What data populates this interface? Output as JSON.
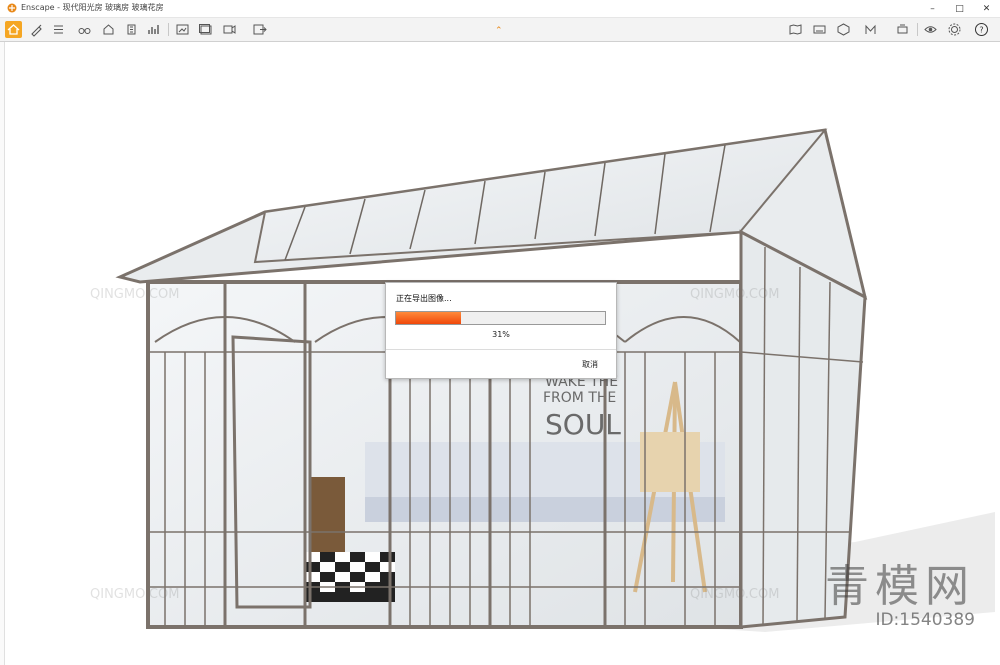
{
  "window": {
    "app_name": "Enscape",
    "title": "Enscape - 现代阳光房 玻璃房 玻璃花房",
    "buttons": [
      "minimize",
      "maximize",
      "close"
    ]
  },
  "toolbar": {
    "left_icons": [
      "home-icon",
      "pen-icon",
      "list-icon",
      "binoculars-icon",
      "house-icon",
      "building-icon",
      "chart-icon",
      "sun-icon",
      "render-icon",
      "render-batch-icon",
      "video-icon",
      "export-icon"
    ],
    "right_icons": [
      "map-icon",
      "panorama-icon",
      "vr-icon",
      "material-icon",
      "settings-alt-icon",
      "eye-icon",
      "settings-icon",
      "help-icon"
    ],
    "accent": "#f5a623"
  },
  "dialog": {
    "title": "正在导出图像...",
    "progress": 0.31,
    "progress_text": "31%",
    "cancel_label": "取消",
    "fill_color": "#f0480a"
  },
  "scene": {
    "sign_line1": "WAKE THE",
    "sign_line2": "FROM THE",
    "sign_line3": "SOUL"
  },
  "watermark": {
    "text": "QINGMO.COM",
    "logo": "青模网",
    "id": "ID:1540389"
  }
}
